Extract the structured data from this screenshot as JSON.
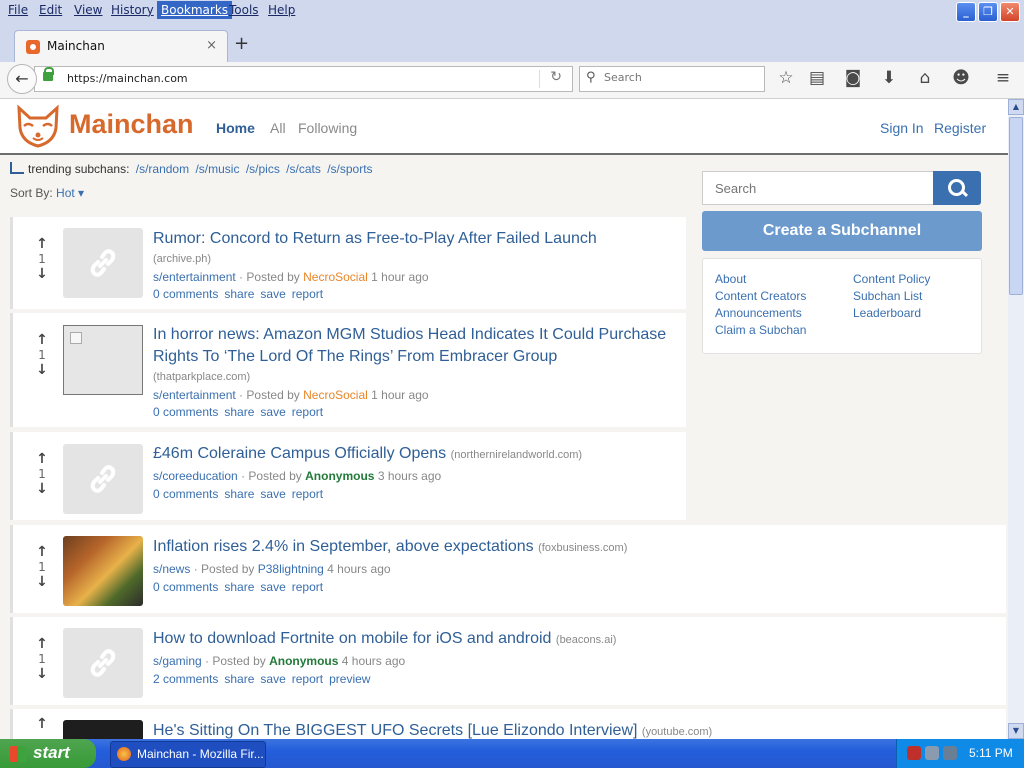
{
  "browser": {
    "menu": [
      "File",
      "Edit",
      "View",
      "History",
      "Bookmarks",
      "Tools",
      "Help"
    ],
    "tab_title": "Mainchan",
    "new_tab": "+",
    "tab_close": "×",
    "url": "https://mainchan.com",
    "search_placeholder": "Search"
  },
  "site": {
    "logo_text": "Mainchan",
    "nav": {
      "home": "Home",
      "all": "All",
      "following": "Following"
    },
    "auth": {
      "signin": "Sign In",
      "register": "Register"
    },
    "trending_label": "trending subchans:",
    "trending": [
      "/s/random",
      "/s/music",
      "/s/pics",
      "/s/cats",
      "/s/sports"
    ],
    "sort_label": "Sort By:",
    "sort_value": "Hot ▾"
  },
  "sidebar": {
    "search_placeholder": "Search",
    "create_button": "Create a Subchannel",
    "links_left": [
      "About",
      "Content Creators",
      "Announcements",
      "Claim a Subchan"
    ],
    "links_right": [
      "Content Policy",
      "Subchan List",
      "Leaderboard"
    ]
  },
  "posts": [
    {
      "score": "1",
      "title": "Rumor: Concord to Return as Free-to-Play After Failed Launch",
      "domain": "(archive.ph)",
      "sub": "s/entertainment",
      "posted_by": "Posted by",
      "user": "NecroSocial",
      "time": "1 hour ago",
      "actions": [
        "0 comments",
        "share",
        "save",
        "report"
      ]
    },
    {
      "score": "1",
      "title": "In horror news: Amazon MGM Studios Head Indicates It Could Purchase Rights To ‘The Lord Of The Rings’ From Embracer Group",
      "domain": "(thatparkplace.com)",
      "sub": "s/entertainment",
      "posted_by": "Posted by",
      "user": "NecroSocial",
      "time": "1 hour ago",
      "actions": [
        "0 comments",
        "share",
        "save",
        "report"
      ]
    },
    {
      "score": "1",
      "title": "£46m Coleraine Campus Officially Opens",
      "domain": "(northernirelandworld.com)",
      "sub": "s/coreeducation",
      "posted_by": "Posted by",
      "user": "Anonymous",
      "time": "3 hours ago",
      "actions": [
        "0 comments",
        "share",
        "save",
        "report"
      ]
    },
    {
      "score": "1",
      "title": "Inflation rises 2.4% in September, above expectations",
      "domain": "(foxbusiness.com)",
      "sub": "s/news",
      "posted_by": "Posted by",
      "user": "P38lightning",
      "time": "4 hours ago",
      "actions": [
        "0 comments",
        "share",
        "save",
        "report"
      ]
    },
    {
      "score": "1",
      "title": "How to download Fortnite on mobile for iOS and android",
      "domain": "(beacons.ai)",
      "sub": "s/gaming",
      "posted_by": "Posted by",
      "user": "Anonymous",
      "time": "4 hours ago",
      "actions": [
        "2 comments",
        "share",
        "save",
        "report",
        "preview"
      ]
    },
    {
      "title": "He's Sitting On The BIGGEST UFO Secrets [Lue Elizondo Interview]",
      "domain": "(youtube.com)"
    }
  ],
  "taskbar": {
    "start": "start",
    "task": "Mainchan - Mozilla Fir...",
    "clock": "5:11 PM"
  },
  "colors": {
    "brand": "#d8692d",
    "link": "#3a70b0",
    "create_button": "#6d9acd",
    "anonymous": "#237a3a",
    "username": "#e8862a"
  }
}
